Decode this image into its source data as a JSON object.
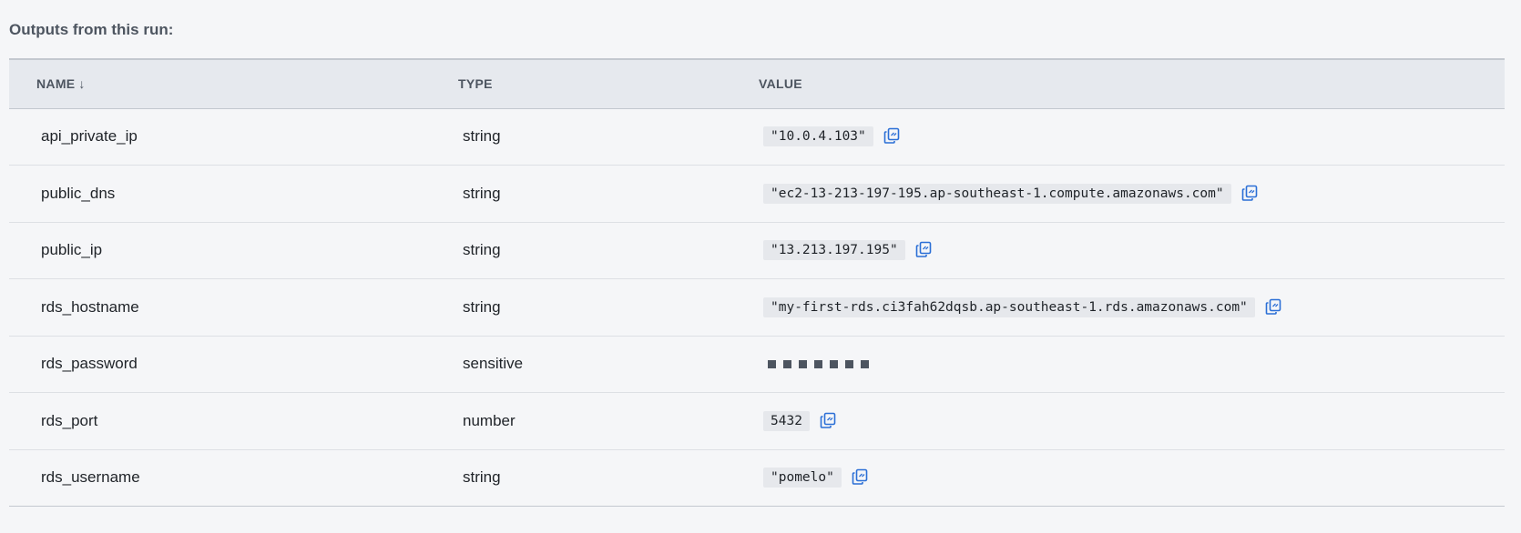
{
  "section": {
    "title": "Outputs from this run:"
  },
  "table": {
    "headers": {
      "name": "NAME",
      "name_sort_indicator": "↓",
      "type": "TYPE",
      "value": "VALUE"
    },
    "rows": [
      {
        "name": "api_private_ip",
        "type": "string",
        "value": "\"10.0.4.103\"",
        "sensitive": false,
        "copyable": true
      },
      {
        "name": "public_dns",
        "type": "string",
        "value": "\"ec2-13-213-197-195.ap-southeast-1.compute.amazonaws.com\"",
        "sensitive": false,
        "copyable": true
      },
      {
        "name": "public_ip",
        "type": "string",
        "value": "\"13.213.197.195\"",
        "sensitive": false,
        "copyable": true
      },
      {
        "name": "rds_hostname",
        "type": "string",
        "value": "\"my-first-rds.ci3fah62dqsb.ap-southeast-1.rds.amazonaws.com\"",
        "sensitive": false,
        "copyable": true
      },
      {
        "name": "rds_password",
        "type": "sensitive",
        "value": "",
        "sensitive": true,
        "mask_count": 7,
        "copyable": false
      },
      {
        "name": "rds_port",
        "type": "number",
        "value": "5432",
        "sensitive": false,
        "copyable": true
      },
      {
        "name": "rds_username",
        "type": "string",
        "value": "\"pomelo\"",
        "sensitive": false,
        "copyable": true
      }
    ]
  },
  "icons": {
    "copy": "copy-icon"
  },
  "colors": {
    "copy_icon": "#2b6fd6",
    "header_bg": "#e6e9ee",
    "page_bg": "#f5f6f8"
  }
}
